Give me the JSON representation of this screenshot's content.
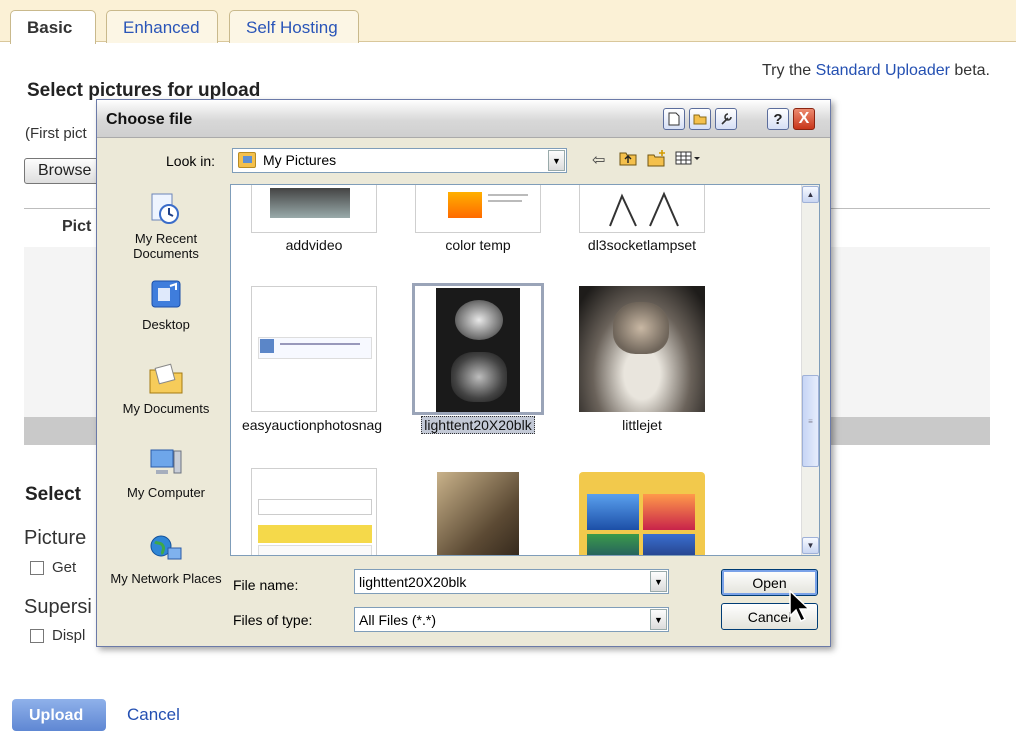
{
  "tabs": [
    {
      "label": "Basic",
      "active": true
    },
    {
      "label": "Enhanced",
      "active": false
    },
    {
      "label": "Self Hosting",
      "active": false
    }
  ],
  "page": {
    "try_prefix": "Try the",
    "try_link": "Standard Uploader",
    "try_suffix": "beta.",
    "heading": "Select pictures for upload",
    "first_pic_text": "(First pict",
    "browse_label": "Browse",
    "pict_header": "Pict",
    "select_heading": "Select",
    "picture_label": "Picture",
    "picture_option": "Get",
    "supersize_label": "Supersi",
    "supersize_option": "Displ",
    "upload_label": "Upload",
    "cancel_label": "Cancel"
  },
  "dialog": {
    "title": "Choose file",
    "help_label": "?",
    "close_label": "X",
    "look_in_label": "Look in:",
    "look_in_value": "My Pictures",
    "places": [
      {
        "label": "My Recent Documents",
        "icon": "recent-documents-icon"
      },
      {
        "label": "Desktop",
        "icon": "desktop-icon"
      },
      {
        "label": "My Documents",
        "icon": "my-documents-icon"
      },
      {
        "label": "My Computer",
        "icon": "my-computer-icon"
      },
      {
        "label": "My Network Places",
        "icon": "network-places-icon"
      }
    ],
    "files": [
      {
        "name": "addvideo",
        "selected": false
      },
      {
        "name": "color temp",
        "selected": false
      },
      {
        "name": "dl3socketlampset",
        "selected": false
      },
      {
        "name": "easyauctionphotosnag",
        "selected": false
      },
      {
        "name": "lighttent20X20blk",
        "selected": true
      },
      {
        "name": "littlejet",
        "selected": false
      },
      {
        "name": "",
        "selected": false
      },
      {
        "name": "",
        "selected": false
      },
      {
        "name": "",
        "selected": false
      }
    ],
    "file_name_label": "File name:",
    "file_name_value": "lighttent20X20blk",
    "file_type_label": "Files of type:",
    "file_type_value": "All Files (*.*)",
    "open_label": "Open",
    "cancel_label": "Cancel"
  },
  "colors": {
    "link": "#2450b2",
    "tab_band": "#fbf1d6",
    "dialog_bg": "#ece9d8",
    "upload_button": "#6f93d9"
  }
}
